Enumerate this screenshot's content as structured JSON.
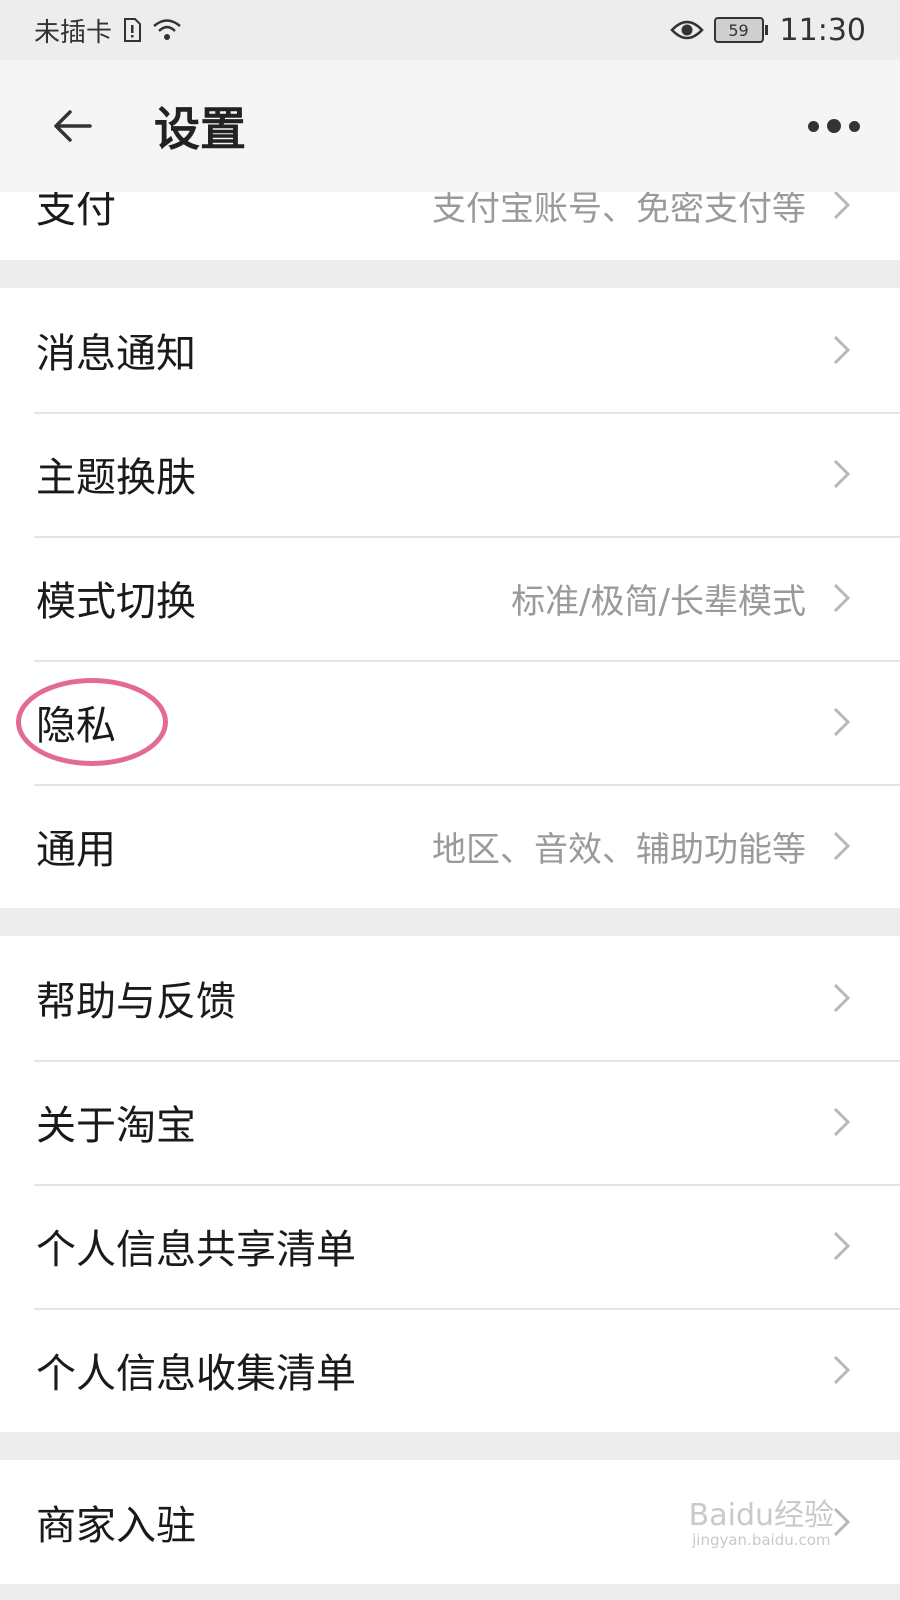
{
  "statusbar": {
    "carrier": "未插卡",
    "battery": "59",
    "time": "11:30"
  },
  "header": {
    "title": "设置"
  },
  "groups": [
    {
      "rows": [
        {
          "label": "支付",
          "hint": "支付宝账号、免密支付等"
        }
      ]
    },
    {
      "rows": [
        {
          "label": "消息通知",
          "hint": ""
        },
        {
          "label": "主题换肤",
          "hint": ""
        },
        {
          "label": "模式切换",
          "hint": "标准/极简/长辈模式"
        },
        {
          "label": "隐私",
          "hint": ""
        },
        {
          "label": "通用",
          "hint": "地区、音效、辅助功能等"
        }
      ]
    },
    {
      "rows": [
        {
          "label": "帮助与反馈",
          "hint": ""
        },
        {
          "label": "关于淘宝",
          "hint": ""
        },
        {
          "label": "个人信息共享清单",
          "hint": ""
        },
        {
          "label": "个人信息收集清单",
          "hint": ""
        }
      ]
    },
    {
      "rows": [
        {
          "label": "商家入驻",
          "hint": ""
        }
      ]
    }
  ],
  "watermark": {
    "brand": "Baidu经验",
    "url": "jingyan.baidu.com"
  },
  "colors": {
    "annotation_circle": "#e36a95",
    "background": "#ededed"
  },
  "icons": {
    "back": "arrow-left-icon",
    "more": "more-dots-icon",
    "row": "chevron-right-icon"
  }
}
